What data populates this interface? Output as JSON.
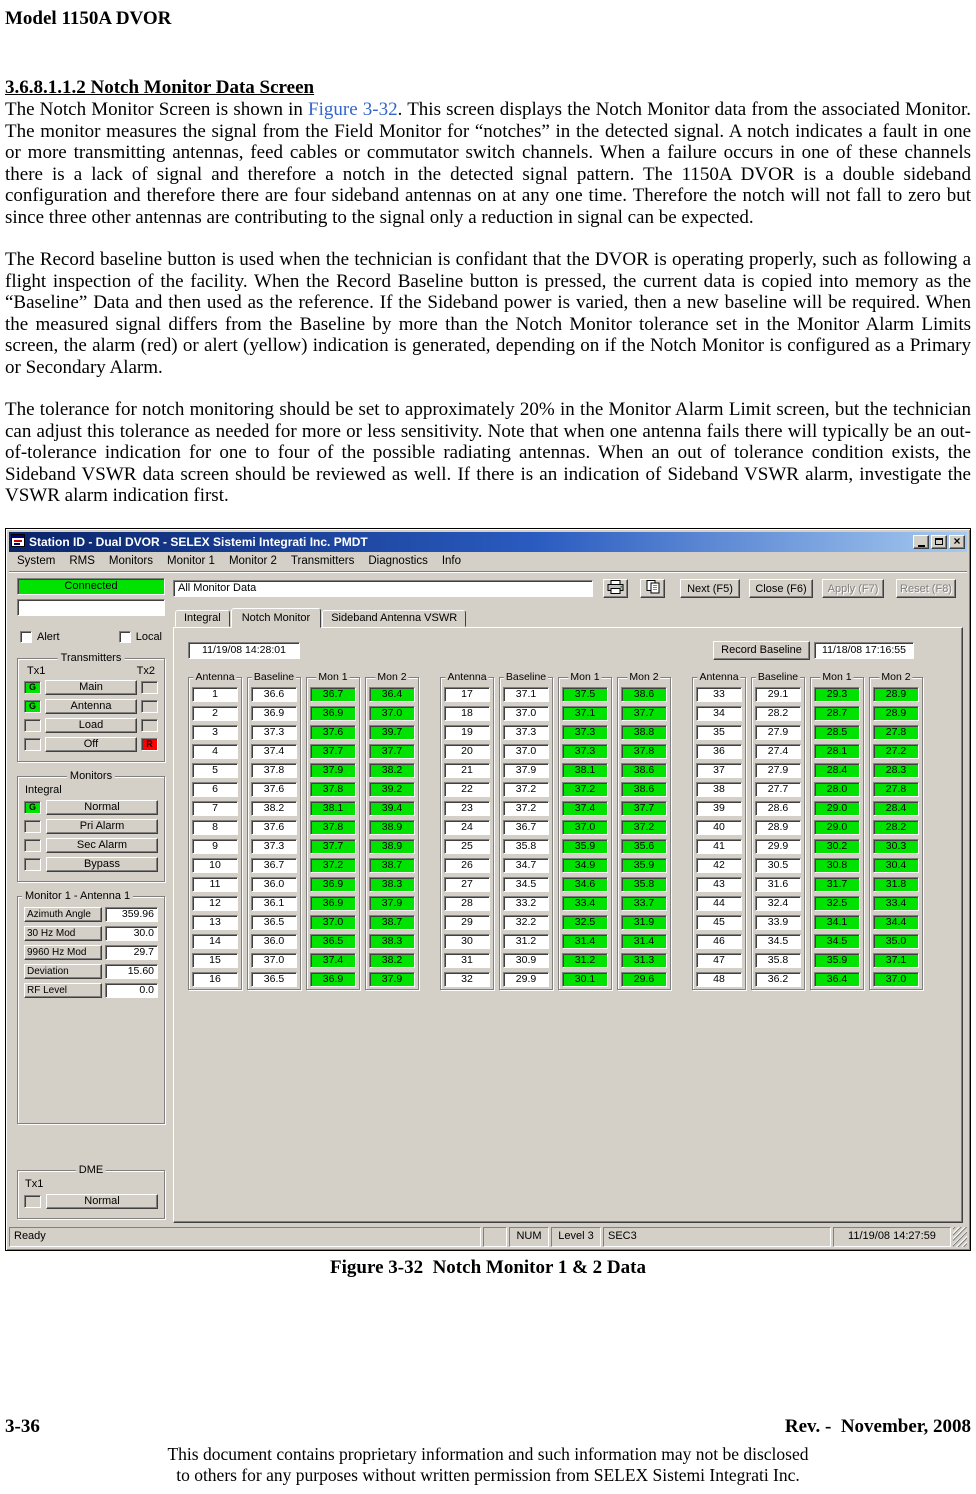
{
  "colors": {
    "window_gray": "#d4d0c8",
    "titlebar_left": "#0a246a",
    "titlebar_right": "#a6caf0",
    "status_green": "#00e300",
    "alarm_red": "#ff0000",
    "link_blue": "#3366cc"
  },
  "doc": {
    "header": "Model 1150A DVOR",
    "heading": "3.6.8.1.1.2 Notch Monitor Data Screen",
    "para1_pre": "The Notch Monitor Screen is shown in ",
    "para1_link": "Figure 3-32",
    "para1_post": ". This screen displays the Notch Monitor data from the associated Monitor. The monitor measures the signal from the Field Monitor for “notches” in the detected signal. A notch indicates a fault in one or more transmitting antennas, feed cables or commutator switch channels. When a failure occurs in one of these channels there is a lack of signal and therefore a notch in the detected signal pattern. The 1150A DVOR is a double sideband configuration and therefore there are four sideband antennas on at any one time. Therefore the notch will not fall to zero but since three other antennas are contributing to the signal only a reduction in signal can be expected.",
    "para2": "The Record baseline button is used when the technician is confidant that the DVOR is operating properly, such as following a flight inspection of the facility. When the Record Baseline button is pressed, the current data is copied into memory as the “Baseline” Data and then used as the reference. If the Sideband power is varied, then a new baseline will be required. When the measured signal differs from the Baseline by more than the Notch Monitor tolerance set in the Monitor Alarm Limits screen, the alarm (red) or alert (yellow) indication is generated, depending on if the Notch Monitor is configured as a Primary or Secondary Alarm.",
    "para3": "The tolerance for notch monitoring should be set to approximately 20% in the Monitor Alarm Limit screen, but the technician can adjust this tolerance as needed for more or less sensitivity. Note that when one antenna fails there will typically be an out-of-tolerance indication for one to four of the possible radiating antennas. When an out of tolerance condition exists, the Sideband VSWR data screen should be reviewed as well. If there is an indication of Sideband VSWR alarm, investigate the VSWR alarm indication first.",
    "figure_caption": "Figure 3-32  Notch Monitor 1 & 2 Data",
    "footer_left": "3-36",
    "footer_right": "Rev. -  November, 2008",
    "disclaimer_line1": "This document contains proprietary information and such information may not be disclosed",
    "disclaimer_line2": "to others for any purposes without written permission from SELEX Sistemi Integrati Inc."
  },
  "app": {
    "title": "Station ID - Dual DVOR - SELEX Sistemi Integrati Inc. PMDT",
    "menu": [
      "System",
      "RMS",
      "Monitors",
      "Monitor 1",
      "Monitor 2",
      "Transmitters",
      "Diagnostics",
      "Info"
    ],
    "toolbar": {
      "data_selector": "All Monitor Data",
      "next": "Next (F5)",
      "close": "Close (F6)",
      "apply": "Apply (F7)",
      "reset": "Reset (F8)"
    },
    "sidebar": {
      "connected": "Connected",
      "alert": "Alert",
      "local": "Local",
      "transmitters": {
        "title": "Transmitters",
        "tx1": "Tx1",
        "tx2": "Tx2",
        "rows": [
          {
            "label": "Main",
            "tx1": "G",
            "tx2": ""
          },
          {
            "label": "Antenna",
            "tx1": "G",
            "tx2": ""
          },
          {
            "label": "Load",
            "tx1": "",
            "tx2": ""
          },
          {
            "label": "Off",
            "tx1": "",
            "tx2": "R"
          }
        ]
      },
      "monitors": {
        "title": "Monitors",
        "subtitle": "Integral",
        "rows": [
          {
            "label": "Normal",
            "ind": "G"
          },
          {
            "label": "Pri Alarm",
            "ind": ""
          },
          {
            "label": "Sec Alarm",
            "ind": ""
          },
          {
            "label": "Bypass",
            "ind": ""
          }
        ]
      },
      "monitor1": {
        "title": "Monitor 1 - Antenna 1",
        "fields": [
          {
            "label": "Azimuth Angle",
            "value": "359.96"
          },
          {
            "label": "30 Hz Mod",
            "value": "30.0"
          },
          {
            "label": "9960 Hz Mod",
            "value": "29.7"
          },
          {
            "label": "Deviation",
            "value": "15.60"
          },
          {
            "label": "RF Level",
            "value": "0.0"
          }
        ]
      },
      "dme": {
        "title": "DME",
        "tx1": "Tx1",
        "normal": "Normal"
      }
    },
    "tabs": [
      {
        "label": "Integral",
        "selected": false
      },
      {
        "label": "Notch Monitor",
        "selected": true
      },
      {
        "label": "Sideband Antenna VSWR",
        "selected": false
      }
    ],
    "panel": {
      "timestamp": "11/19/08 14:28:01",
      "record_baseline": "Record Baseline",
      "baseline_timestamp": "11/18/08 17:16:55"
    },
    "statusbar": {
      "ready": "Ready",
      "num": "NUM",
      "level": "Level 3",
      "sec": "SEC3",
      "datetime": "11/19/08 14:27:59"
    }
  },
  "tables": {
    "columns": [
      "Antenna",
      "Baseline",
      "Mon 1",
      "Mon 2"
    ],
    "groups": [
      {
        "rows": [
          [
            "1",
            "36.6",
            "36.7",
            "36.4"
          ],
          [
            "2",
            "36.9",
            "36.9",
            "37.0"
          ],
          [
            "3",
            "37.3",
            "37.6",
            "39.7"
          ],
          [
            "4",
            "37.4",
            "37.7",
            "37.7"
          ],
          [
            "5",
            "37.8",
            "37.9",
            "38.2"
          ],
          [
            "6",
            "37.6",
            "37.8",
            "39.2"
          ],
          [
            "7",
            "38.2",
            "38.1",
            "39.4"
          ],
          [
            "8",
            "37.6",
            "37.8",
            "38.9"
          ],
          [
            "9",
            "37.3",
            "37.7",
            "38.9"
          ],
          [
            "10",
            "36.7",
            "37.2",
            "38.7"
          ],
          [
            "11",
            "36.0",
            "36.9",
            "38.3"
          ],
          [
            "12",
            "36.1",
            "36.9",
            "37.9"
          ],
          [
            "13",
            "36.5",
            "37.0",
            "38.7"
          ],
          [
            "14",
            "36.0",
            "36.5",
            "38.3"
          ],
          [
            "15",
            "37.0",
            "37.4",
            "38.2"
          ],
          [
            "16",
            "36.5",
            "36.9",
            "37.9"
          ]
        ]
      },
      {
        "rows": [
          [
            "17",
            "37.1",
            "37.5",
            "38.6"
          ],
          [
            "18",
            "37.0",
            "37.1",
            "37.7"
          ],
          [
            "19",
            "37.3",
            "37.3",
            "38.8"
          ],
          [
            "20",
            "37.0",
            "37.3",
            "37.8"
          ],
          [
            "21",
            "37.9",
            "38.1",
            "38.6"
          ],
          [
            "22",
            "37.2",
            "37.2",
            "38.6"
          ],
          [
            "23",
            "37.2",
            "37.4",
            "37.7"
          ],
          [
            "24",
            "36.7",
            "37.0",
            "37.2"
          ],
          [
            "25",
            "35.8",
            "35.9",
            "35.6"
          ],
          [
            "26",
            "34.7",
            "34.9",
            "35.9"
          ],
          [
            "27",
            "34.5",
            "34.6",
            "35.8"
          ],
          [
            "28",
            "33.2",
            "33.4",
            "33.7"
          ],
          [
            "29",
            "32.2",
            "32.5",
            "31.9"
          ],
          [
            "30",
            "31.2",
            "31.4",
            "31.4"
          ],
          [
            "31",
            "30.9",
            "31.2",
            "31.3"
          ],
          [
            "32",
            "29.9",
            "30.1",
            "29.6"
          ]
        ]
      },
      {
        "rows": [
          [
            "33",
            "29.1",
            "29.3",
            "28.9"
          ],
          [
            "34",
            "28.2",
            "28.7",
            "28.9"
          ],
          [
            "35",
            "27.9",
            "28.5",
            "27.8"
          ],
          [
            "36",
            "27.4",
            "28.1",
            "27.2"
          ],
          [
            "37",
            "27.9",
            "28.4",
            "28.3"
          ],
          [
            "38",
            "27.7",
            "28.0",
            "27.8"
          ],
          [
            "39",
            "28.6",
            "29.0",
            "28.4"
          ],
          [
            "40",
            "28.9",
            "29.0",
            "28.2"
          ],
          [
            "41",
            "29.9",
            "30.2",
            "30.3"
          ],
          [
            "42",
            "30.5",
            "30.8",
            "30.4"
          ],
          [
            "43",
            "31.6",
            "31.7",
            "31.8"
          ],
          [
            "44",
            "32.4",
            "32.5",
            "33.4"
          ],
          [
            "45",
            "33.9",
            "34.1",
            "34.4"
          ],
          [
            "46",
            "34.5",
            "34.5",
            "35.0"
          ],
          [
            "47",
            "35.8",
            "35.9",
            "37.1"
          ],
          [
            "48",
            "36.2",
            "36.4",
            "37.0"
          ]
        ]
      }
    ]
  }
}
